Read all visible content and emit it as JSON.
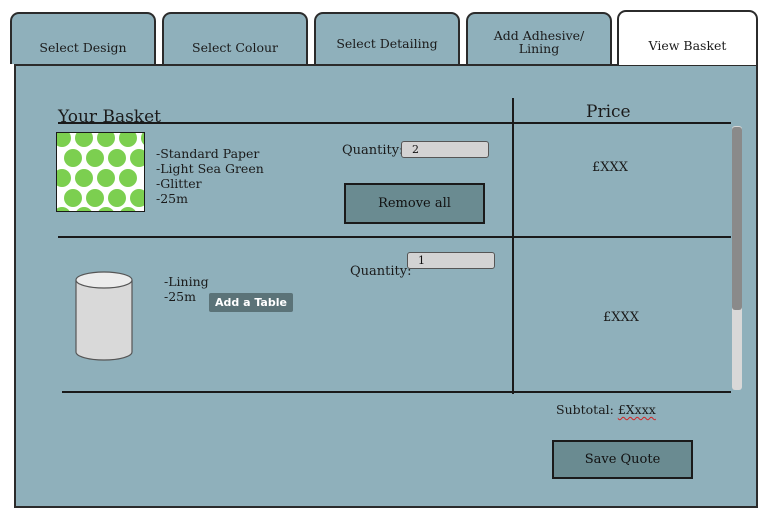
{
  "tabs": [
    {
      "label": "Select Design"
    },
    {
      "label": "Select Colour"
    },
    {
      "label": "Select Detailing"
    },
    {
      "label": "Add Adhesive/ Lining",
      "line1": "Add Adhesive/",
      "line2": "Lining"
    },
    {
      "label": "View Basket",
      "active": true
    }
  ],
  "basket": {
    "title": "Your Basket",
    "price_header": "Price"
  },
  "items": [
    {
      "thumbnail_icon": "green-dot-pattern-swatch",
      "details": [
        "-Standard Paper",
        "-Light Sea Green",
        "-Glitter",
        "-25m"
      ],
      "quantity_label": "Quantity:",
      "quantity": "2",
      "remove_label": "Remove all",
      "price": "£XXX"
    },
    {
      "thumbnail_icon": "cylinder-roll-icon",
      "details": [
        "-Lining",
        "-25m"
      ],
      "quantity_label": "Quantity:",
      "quantity": "1",
      "price": "£XXX"
    }
  ],
  "tooltip": "Add a Table",
  "subtotal": {
    "label": "Subtotal: ",
    "value": "£Xxxx"
  },
  "save_quote_label": "Save Quote",
  "colors": {
    "panel": "#8fb0bb",
    "button": "#6a8b91",
    "swatch_green": "#7ccf50",
    "tooltip_bg": "#5b7378"
  }
}
